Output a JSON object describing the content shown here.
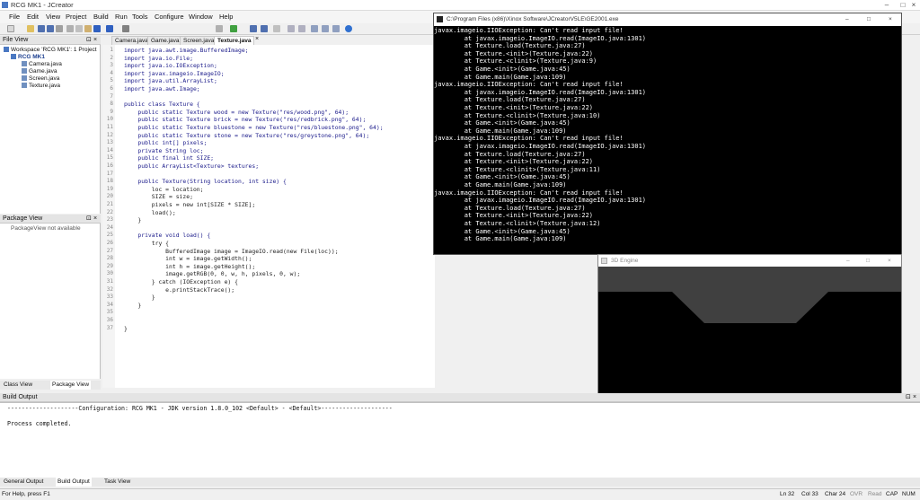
{
  "app": {
    "title": "RCG MK1 - JCreator",
    "menu": [
      "File",
      "Edit",
      "View",
      "Project",
      "Build",
      "Run",
      "Tools",
      "Configure",
      "Window",
      "Help"
    ]
  },
  "file_view": {
    "title": "File View",
    "workspace": "Workspace 'RCG MK1': 1 Project",
    "project": "RCG MK1",
    "files": [
      "Camera.java",
      "Game.java",
      "Screen.java",
      "Texture.java"
    ]
  },
  "package_view": {
    "title": "Package View",
    "empty_text": "PackageView not available",
    "tabs": [
      "Class View",
      "Package View"
    ]
  },
  "editor": {
    "tabs": [
      "Camera.java",
      "Game.java",
      "Screen.java",
      "Texture.java"
    ],
    "active_tab": "Texture.java",
    "line_numbers": [
      "1",
      "2",
      "3",
      "4",
      "5",
      "6",
      "7",
      "8",
      "9",
      "10",
      "11",
      "12",
      "13",
      "14",
      "15",
      "16",
      "17",
      "18",
      "19",
      "20",
      "21",
      "22",
      "23",
      "24",
      "25",
      "26",
      "27",
      "28",
      "29",
      "30",
      "31",
      "32",
      "33",
      "34",
      "35",
      "36",
      "37"
    ],
    "code": [
      "import java.awt.image.BufferedImage;",
      "import java.io.File;",
      "import java.io.IOException;",
      "import javax.imageio.ImageIO;",
      "import java.util.ArrayList;",
      "import java.awt.Image;",
      "",
      "public class Texture {",
      "    public static Texture wood = new Texture(\"res/wood.png\", 64);",
      "    public static Texture brick = new Texture(\"res/redbrick.png\", 64);",
      "    public static Texture bluestone = new Texture(\"res/bluestone.png\", 64);",
      "    public static Texture stone = new Texture(\"res/greystone.png\", 64);",
      "    public int[] pixels;",
      "    private String loc;",
      "    public final int SIZE;",
      "    public ArrayList<Texture> textures;",
      "",
      "    public Texture(String location, int size) {",
      "        loc = location;",
      "        SIZE = size;",
      "        pixels = new int[SIZE * SIZE];",
      "        load();",
      "    }",
      "",
      "    private void load() {",
      "        try {",
      "            BufferedImage image = ImageIO.read(new File(loc));",
      "            int w = image.getWidth();",
      "            int h = image.getHeight();",
      "            image.getRGB(0, 0, w, h, pixels, 0, w);",
      "        } catch (IOException e) {",
      "            e.printStackTrace();",
      "        }",
      "    }",
      "",
      "",
      "}"
    ]
  },
  "console": {
    "title": "C:\\Program Files (x86)\\Xinox Software\\JCreatorV5LE\\GE2001.exe",
    "lines": [
      "javax.imageio.IIOException: Can't read input file!",
      "        at javax.imageio.ImageIO.read(ImageIO.java:1301)",
      "        at Texture.load(Texture.java:27)",
      "        at Texture.<init>(Texture.java:22)",
      "        at Texture.<clinit>(Texture.java:9)",
      "        at Game.<init>(Game.java:45)",
      "        at Game.main(Game.java:109)",
      "javax.imageio.IIOException: Can't read input file!",
      "        at javax.imageio.ImageIO.read(ImageIO.java:1301)",
      "        at Texture.load(Texture.java:27)",
      "        at Texture.<init>(Texture.java:22)",
      "        at Texture.<clinit>(Texture.java:10)",
      "        at Game.<init>(Game.java:45)",
      "        at Game.main(Game.java:109)",
      "javax.imageio.IIOException: Can't read input file!",
      "        at javax.imageio.ImageIO.read(ImageIO.java:1301)",
      "        at Texture.load(Texture.java:27)",
      "        at Texture.<init>(Texture.java:22)",
      "        at Texture.<clinit>(Texture.java:11)",
      "        at Game.<init>(Game.java:45)",
      "        at Game.main(Game.java:109)",
      "javax.imageio.IIOException: Can't read input file!",
      "        at javax.imageio.ImageIO.read(ImageIO.java:1301)",
      "        at Texture.load(Texture.java:27)",
      "        at Texture.<init>(Texture.java:22)",
      "        at Texture.<clinit>(Texture.java:12)",
      "        at Game.<init>(Game.java:45)",
      "        at Game.main(Game.java:109)"
    ]
  },
  "engine": {
    "title": "3D Engine",
    "colors": {
      "ceiling": "#404040",
      "floor": "#808080",
      "wall": "#000000"
    }
  },
  "build_output": {
    "title": "Build Output",
    "lines": [
      "--------------------Configuration: RCG MK1 - JDK version 1.8.0_102 <Default> - <Default>--------------------",
      "",
      "Process completed."
    ],
    "tabs": [
      "General Output",
      "Build Output",
      "Task View"
    ]
  },
  "status": {
    "help": "For Help, press F1",
    "ln": "Ln 32",
    "col": "Col 33",
    "char": "Char 24",
    "ovr": "OVR",
    "read": "Read",
    "cap": "CAP",
    "num": "NUM"
  }
}
